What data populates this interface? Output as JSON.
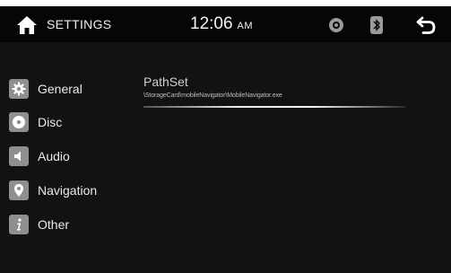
{
  "header": {
    "title": "SETTINGS",
    "time": "12:06",
    "ampm": "AM",
    "icons": [
      "home-icon",
      "disc-icon",
      "bluetooth-icon",
      "back-arrow-icon"
    ]
  },
  "sidebar": {
    "items": [
      {
        "label": "General",
        "icon": "gear-icon"
      },
      {
        "label": "Disc",
        "icon": "disc-icon"
      },
      {
        "label": "Audio",
        "icon": "speaker-icon"
      },
      {
        "label": "Navigation",
        "icon": "location-pin-icon"
      },
      {
        "label": "Other",
        "icon": "info-icon"
      }
    ]
  },
  "main": {
    "setting_title": "PathSet",
    "setting_value": "\\StorageCard\\mobileNavigator\\MobileNavigator.exe"
  },
  "colors": {
    "screen_bg": "#121212",
    "topbar_bg": "#060606",
    "icon_bg": "#8f8f8f",
    "text": "#e9e9e9"
  }
}
